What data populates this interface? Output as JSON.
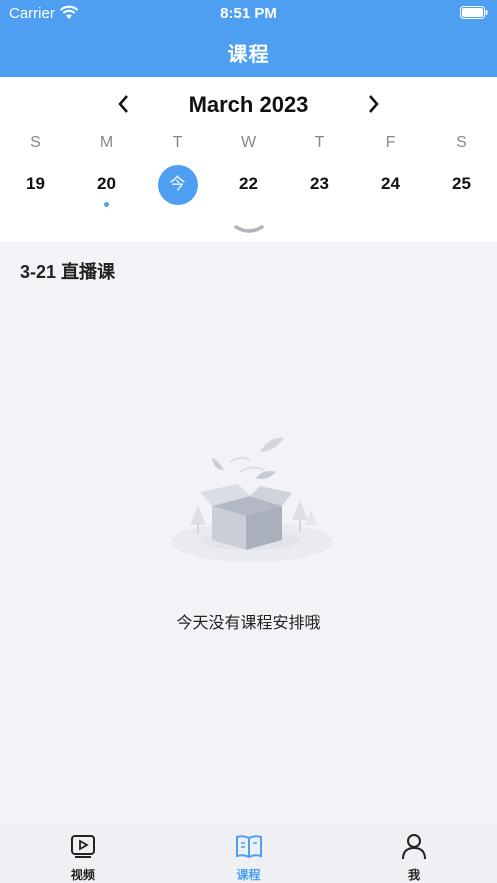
{
  "status_bar": {
    "carrier": "Carrier",
    "time": "8:51 PM"
  },
  "header": {
    "title": "课程"
  },
  "calendar": {
    "month": "March 2023",
    "weekdays": [
      "S",
      "M",
      "T",
      "W",
      "T",
      "F",
      "S"
    ],
    "days": [
      {
        "label": "19"
      },
      {
        "label": "20",
        "has_event": true
      },
      {
        "label": "今",
        "is_today": true
      },
      {
        "label": "22"
      },
      {
        "label": "23"
      },
      {
        "label": "24"
      },
      {
        "label": "25"
      }
    ]
  },
  "section": {
    "title": "3-21 直播课"
  },
  "empty_state": {
    "message": "今天没有课程安排哦",
    "icon": "empty-box-icon"
  },
  "tabbar": {
    "items": [
      {
        "label": "视频",
        "icon": "video-icon",
        "active": false
      },
      {
        "label": "课程",
        "icon": "book-icon",
        "active": true
      },
      {
        "label": "我",
        "icon": "user-icon",
        "active": false
      }
    ]
  },
  "colors": {
    "accent": "#4e9ff2",
    "background": "#f2f2f7",
    "tabbar": "#eef0f4"
  }
}
